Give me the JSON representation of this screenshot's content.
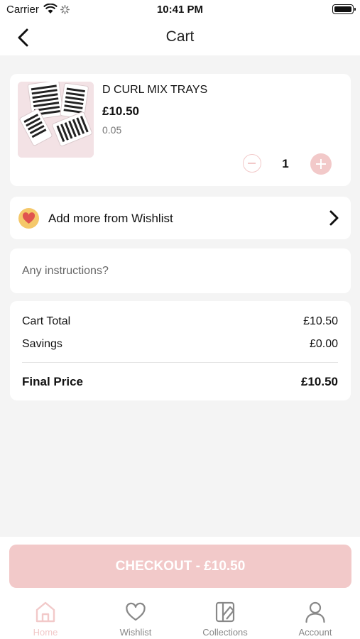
{
  "status_bar": {
    "carrier": "Carrier",
    "time": "10:41 PM",
    "wifi_icon": "wifi-icon",
    "battery_icon": "battery-icon"
  },
  "nav": {
    "title": "Cart",
    "back_icon": "chevron-left-icon"
  },
  "cart_item": {
    "name": "D CURL MIX TRAYS",
    "price": "£10.50",
    "variant": "0.05",
    "quantity": "1",
    "image": "product-image"
  },
  "wishlist": {
    "label": "Add more from Wishlist",
    "icon": "heart-icon"
  },
  "instructions": {
    "placeholder": "Any instructions?",
    "value": ""
  },
  "totals": {
    "cart_total_label": "Cart Total",
    "cart_total_value": "£10.50",
    "savings_label": "Savings",
    "savings_value": "£0.00",
    "final_price_label": "Final Price",
    "final_price_value": "£10.50"
  },
  "checkout": {
    "label": "CHECKOUT - £10.50"
  },
  "tabbar": {
    "items": [
      {
        "label": "Home",
        "icon": "home-icon",
        "active": true
      },
      {
        "label": "Wishlist",
        "icon": "heart-outline-icon",
        "active": false
      },
      {
        "label": "Collections",
        "icon": "collections-icon",
        "active": false
      },
      {
        "label": "Account",
        "icon": "person-icon",
        "active": false
      }
    ]
  },
  "colors": {
    "accent": "#f2c9c9",
    "background": "#f4f4f4",
    "heart_badge": "#f5c86a",
    "heart": "#e0534f"
  }
}
